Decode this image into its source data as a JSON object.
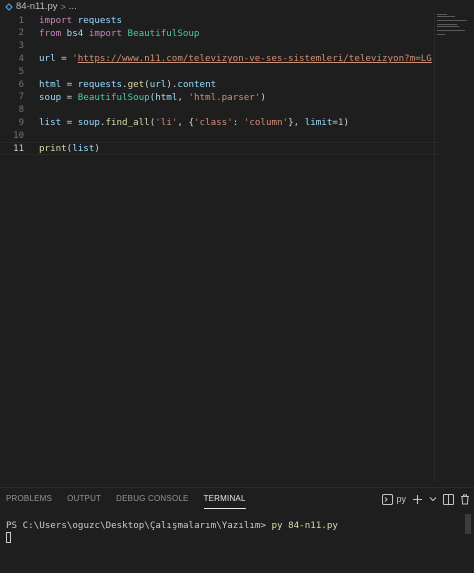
{
  "breadcrumb": {
    "file": "84-n11.py",
    "separator": ">",
    "more": "..."
  },
  "editor": {
    "active_line": "11",
    "lines": [
      {
        "n": "1",
        "tokens": [
          {
            "t": "import",
            "c": "kw"
          },
          {
            "t": " requests",
            "c": "nm"
          }
        ]
      },
      {
        "n": "2",
        "tokens": [
          {
            "t": "from",
            "c": "kw"
          },
          {
            "t": " bs4 ",
            "c": "nm"
          },
          {
            "t": "import",
            "c": "kw"
          },
          {
            "t": " BeautifulSoup",
            "c": "ty"
          }
        ]
      },
      {
        "n": "3",
        "tokens": []
      },
      {
        "n": "4",
        "tokens": [
          {
            "t": "url",
            "c": "nm"
          },
          {
            "t": " = ",
            "c": "pl"
          },
          {
            "t": "'",
            "c": "st"
          },
          {
            "t": "https://www.n11.com/televizyon-ve-ses-sistemleri/televizyon?m=LG",
            "c": "st url"
          },
          {
            "t": "'",
            "c": "st"
          }
        ]
      },
      {
        "n": "5",
        "tokens": []
      },
      {
        "n": "6",
        "tokens": [
          {
            "t": "html",
            "c": "nm"
          },
          {
            "t": " = ",
            "c": "pl"
          },
          {
            "t": "requests",
            "c": "nm"
          },
          {
            "t": ".",
            "c": "pl"
          },
          {
            "t": "get",
            "c": "fn"
          },
          {
            "t": "(",
            "c": "pl"
          },
          {
            "t": "url",
            "c": "nm"
          },
          {
            "t": ").",
            "c": "pl"
          },
          {
            "t": "content",
            "c": "nm"
          }
        ]
      },
      {
        "n": "7",
        "tokens": [
          {
            "t": "soup",
            "c": "nm"
          },
          {
            "t": " = ",
            "c": "pl"
          },
          {
            "t": "BeautifulSoup",
            "c": "ty"
          },
          {
            "t": "(",
            "c": "pl"
          },
          {
            "t": "html",
            "c": "nm"
          },
          {
            "t": ", ",
            "c": "pl"
          },
          {
            "t": "'html.parser'",
            "c": "st"
          },
          {
            "t": ")",
            "c": "pl"
          }
        ]
      },
      {
        "n": "8",
        "tokens": []
      },
      {
        "n": "9",
        "tokens": [
          {
            "t": "list",
            "c": "nm"
          },
          {
            "t": " = ",
            "c": "pl"
          },
          {
            "t": "soup",
            "c": "nm"
          },
          {
            "t": ".",
            "c": "pl"
          },
          {
            "t": "find_all",
            "c": "fn"
          },
          {
            "t": "(",
            "c": "pl"
          },
          {
            "t": "'li'",
            "c": "st"
          },
          {
            "t": ", {",
            "c": "pl"
          },
          {
            "t": "'class'",
            "c": "st"
          },
          {
            "t": ": ",
            "c": "pl"
          },
          {
            "t": "'column'",
            "c": "st"
          },
          {
            "t": "}, ",
            "c": "pl"
          },
          {
            "t": "limit",
            "c": "nm"
          },
          {
            "t": "=",
            "c": "pl"
          },
          {
            "t": "1",
            "c": "num"
          },
          {
            "t": ")",
            "c": "pl"
          }
        ]
      },
      {
        "n": "10",
        "tokens": []
      },
      {
        "n": "11",
        "tokens": [
          {
            "t": "print",
            "c": "fn"
          },
          {
            "t": "(",
            "c": "pl"
          },
          {
            "t": "list",
            "c": "nm"
          },
          {
            "t": ")",
            "c": "pl"
          }
        ]
      }
    ]
  },
  "panel": {
    "tabs": [
      "PROBLEMS",
      "OUTPUT",
      "DEBUG CONSOLE",
      "TERMINAL"
    ],
    "active_tab": "TERMINAL",
    "terminal_selector": "py",
    "actions": {
      "terminal_icon": "terminal-icon",
      "add_icon": "plus-icon",
      "dropdown_icon": "chevron-down-icon",
      "split_icon": "split-icon",
      "trash_icon": "trash-icon"
    },
    "terminal": {
      "prompt": "PS C:\\Users\\oguzc\\Desktop\\Çalışmalarım\\Yazılım> ",
      "command": "py 84-n11.py"
    }
  },
  "colors": {
    "background": "#1e1e1e",
    "keyword": "#c586c0",
    "variable": "#9cdcfe",
    "type": "#4ec9b0",
    "function": "#dcdcaa",
    "string": "#ce9178",
    "number": "#b5cea8"
  }
}
